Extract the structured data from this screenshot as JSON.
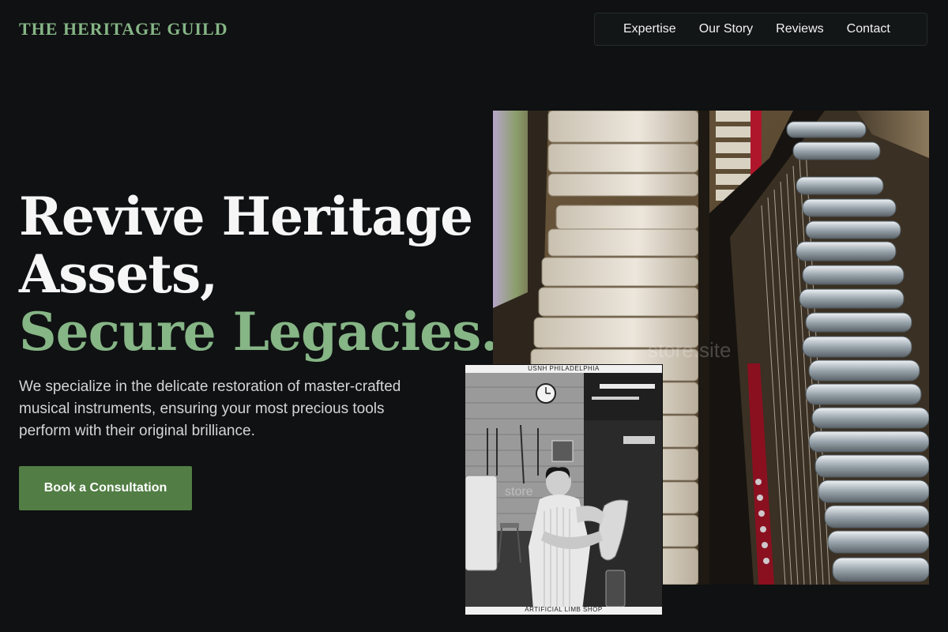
{
  "header": {
    "brand": "THE HERITAGE GUILD",
    "nav": [
      {
        "label": "Expertise"
      },
      {
        "label": "Our Story"
      },
      {
        "label": "Reviews"
      },
      {
        "label": "Contact"
      }
    ]
  },
  "hero": {
    "title_line1": "Revive Heritage",
    "title_line2": "Assets,",
    "title_accent": "Secure Legacies.",
    "description": "We specialize in the delicate restoration of master-crafted musical instruments, ensuring your most precious tools perform with their original brilliance.",
    "cta_label": "Book a Consultation"
  },
  "photos": {
    "piano_watermark": "store.site",
    "archive_caption_top": "USNH  PHILADELPHIA",
    "archive_caption_bottom": "ARTIFICIAL LIMB SHOP",
    "archive_watermark": "store"
  },
  "colors": {
    "background": "#0f1112",
    "accent": "#86b586",
    "button": "#527e45"
  }
}
